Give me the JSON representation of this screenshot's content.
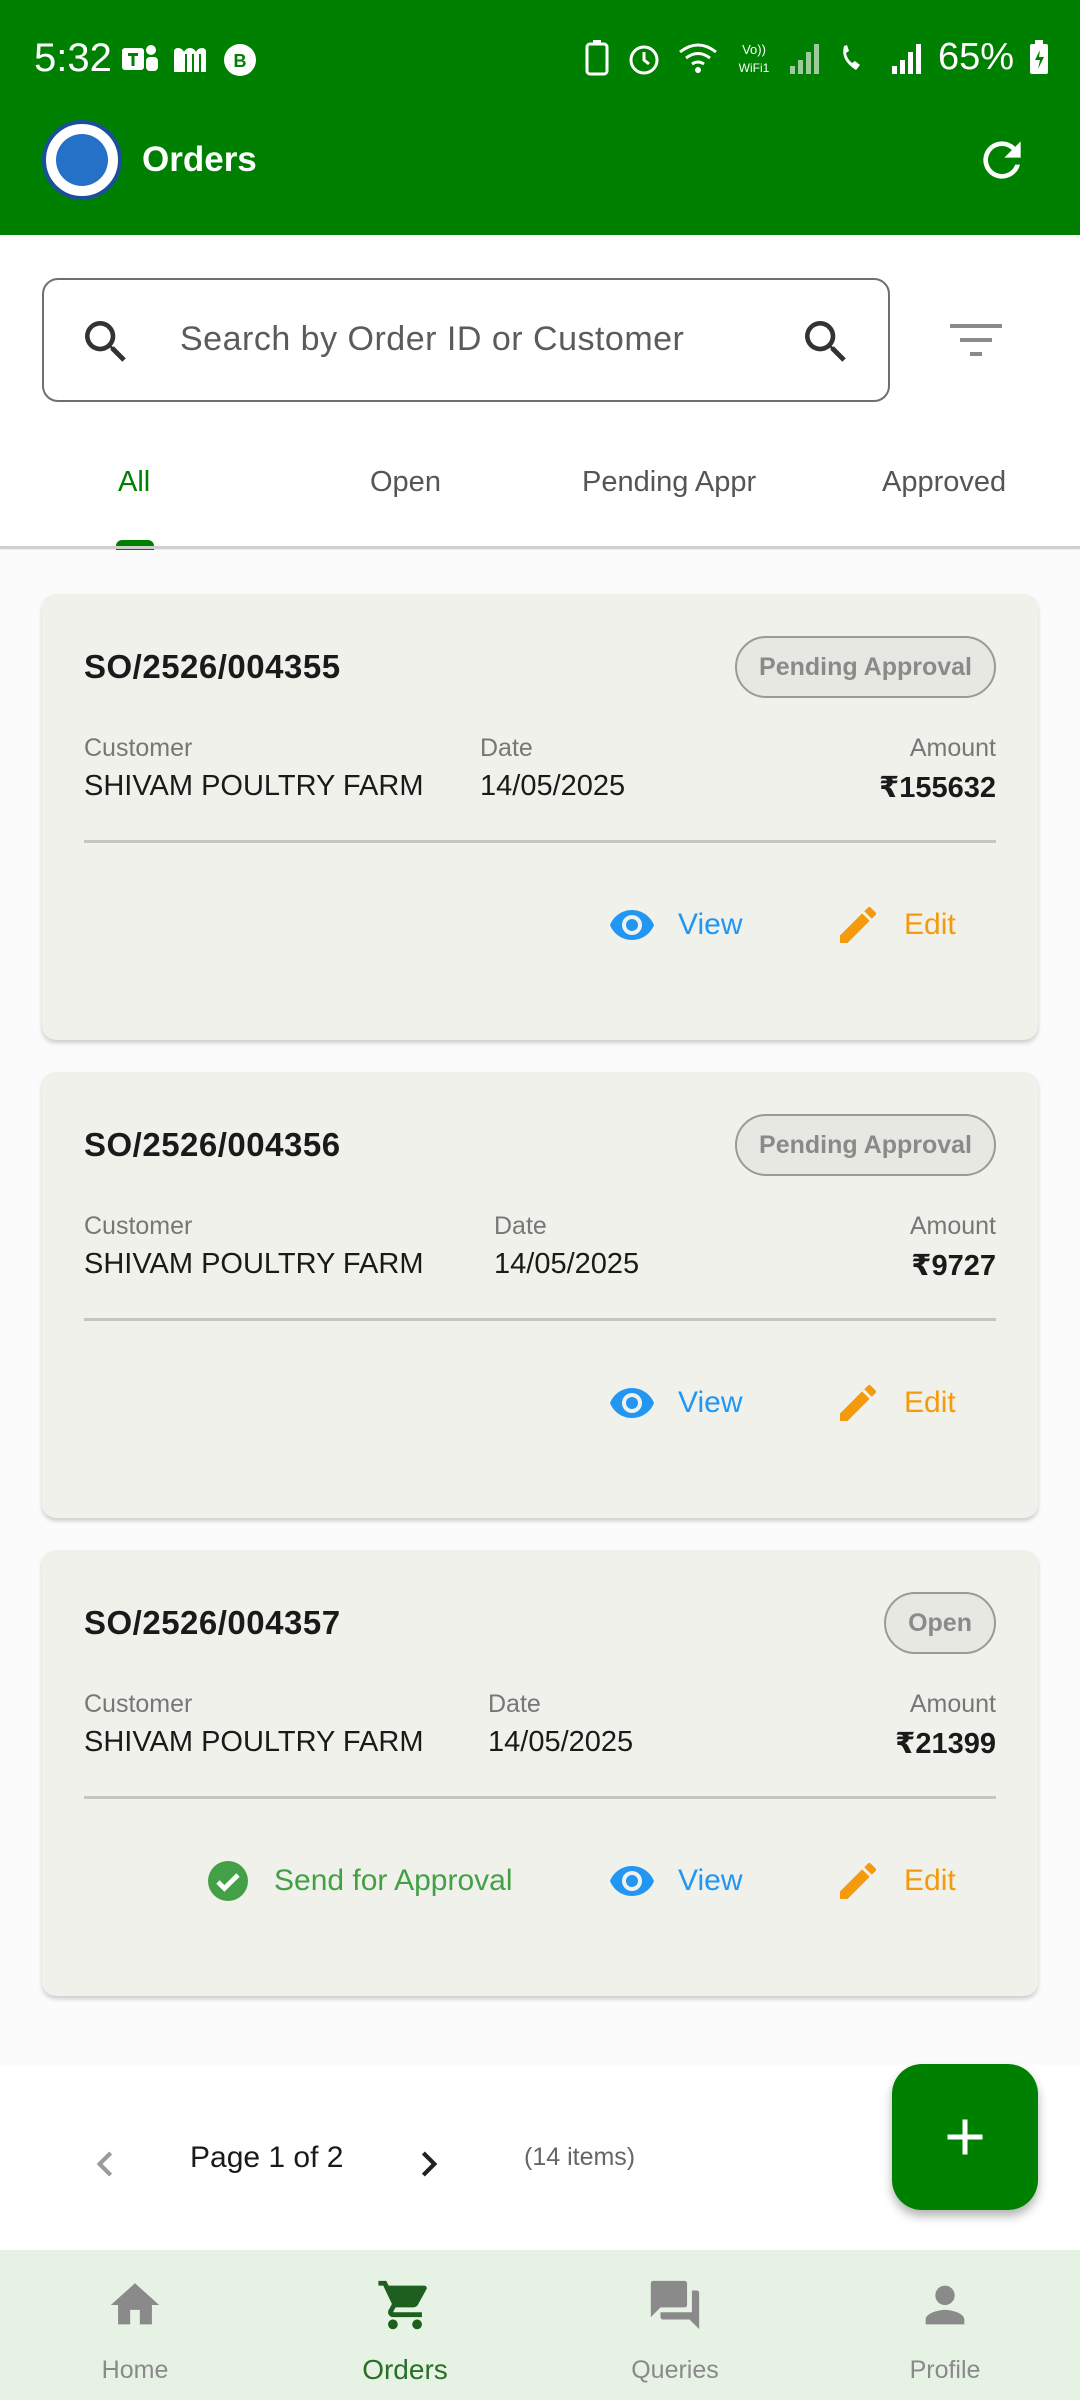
{
  "status_bar": {
    "time": "5:32",
    "battery": "65%"
  },
  "app_bar": {
    "title": "Orders"
  },
  "search": {
    "placeholder": "Search by Order ID or Customer"
  },
  "tabs": [
    {
      "label": "All",
      "active": true
    },
    {
      "label": "Open",
      "active": false
    },
    {
      "label": "Pending Appr",
      "active": false
    },
    {
      "label": "Approved",
      "active": false
    }
  ],
  "labels": {
    "customer": "Customer",
    "date": "Date",
    "amount": "Amount",
    "view": "View",
    "edit": "Edit",
    "send_for_approval": "Send for Approval"
  },
  "orders": [
    {
      "id": "SO/2526/004355",
      "status": "Pending Approval",
      "customer": "SHIVAM POULTRY FARM",
      "date": "14/05/2025",
      "amount": "₹155632"
    },
    {
      "id": "SO/2526/004356",
      "status": "Pending Approval",
      "customer": "SHIVAM POULTRY FARM",
      "date": "14/05/2025",
      "amount": "₹9727"
    },
    {
      "id": "SO/2526/004357",
      "status": "Open",
      "customer": "SHIVAM POULTRY FARM",
      "date": "14/05/2025",
      "amount": "₹21399"
    }
  ],
  "pagination": {
    "page_label": "Page 1 of 2",
    "items_count": "(14 items)"
  },
  "bottom_nav": [
    {
      "label": "Home",
      "icon": "home-icon",
      "active": false
    },
    {
      "label": "Orders",
      "icon": "cart-icon",
      "active": true
    },
    {
      "label": "Queries",
      "icon": "chat-icon",
      "active": false
    },
    {
      "label": "Profile",
      "icon": "person-icon",
      "active": false
    }
  ],
  "colors": {
    "brand_green": "#008000",
    "view_blue": "#2196f3",
    "edit_orange": "#f59a0c",
    "approve_green": "#43a047"
  }
}
